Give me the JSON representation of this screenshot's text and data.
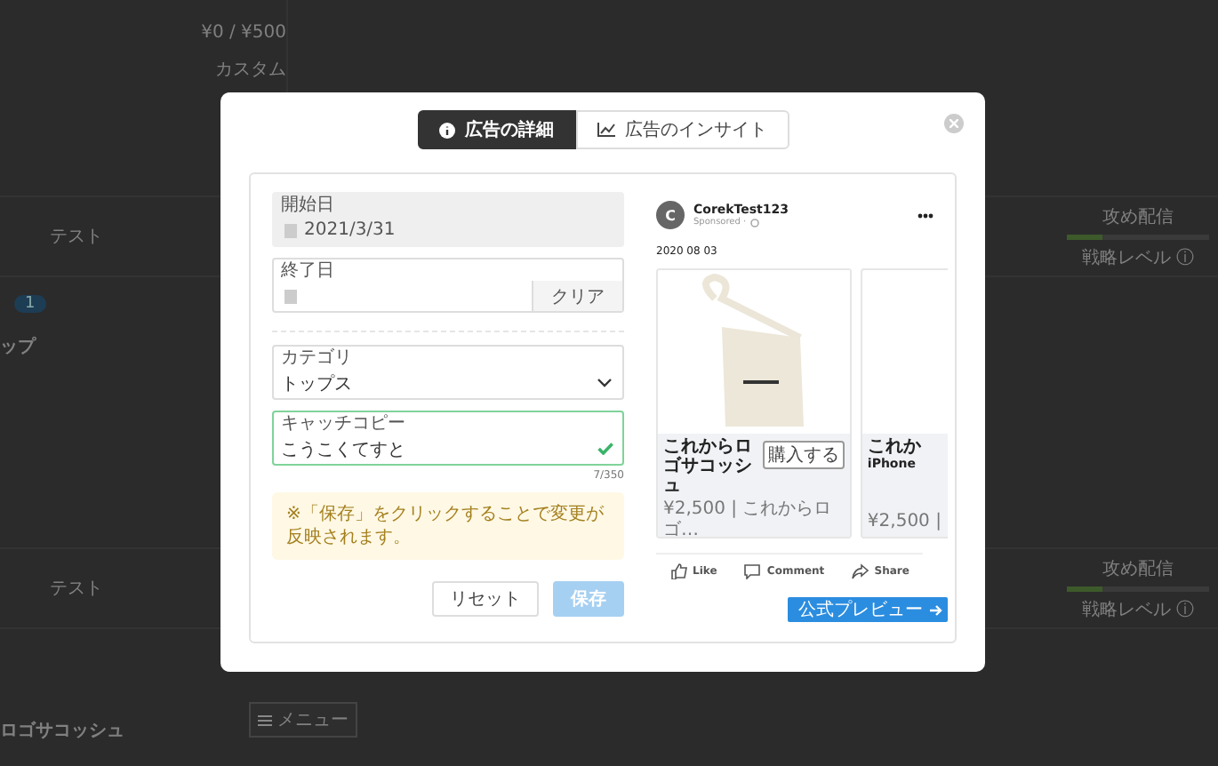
{
  "background": {
    "budget": "¥0 / ¥500",
    "plan": "カスタム",
    "rows": [
      {
        "name": "テスト",
        "strategy": "攻め配信",
        "level": 0.25,
        "level_label": "戦略レベル ⓘ",
        "badge": "1",
        "product": "ップ"
      },
      {
        "name": "テスト",
        "strategy": "攻め配信",
        "level": 0.25,
        "level_label": "戦略レベル ⓘ",
        "product": "ロゴサコッシュ",
        "menu": "メニュー"
      }
    ]
  },
  "modal": {
    "tabs": [
      {
        "label": "広告の詳細",
        "selected": true
      },
      {
        "label": "広告のインサイト",
        "selected": false
      }
    ],
    "form": {
      "fields": [
        {
          "kind": "date",
          "label": "開始日",
          "value": "2021/3/31",
          "disabled": true
        },
        {
          "kind": "date",
          "label": "終了日",
          "disabled": false,
          "clear_button": "クリア"
        },
        {
          "kind": "select",
          "label": "カテゴリ",
          "value": "トップス"
        },
        {
          "kind": "text",
          "label": "キャッチコピー",
          "value": "こうこくてすと",
          "valid": true,
          "counter": "7/350"
        }
      ],
      "notice": "※「保存」をクリックすることで変更が反映されます。",
      "reset_button": "リセット",
      "save_button": {
        "label": "保存",
        "disabled": true
      }
    },
    "preview": {
      "avatar": "C",
      "page_name": "CorekTest123",
      "sponsored": "Sponsored ·",
      "date": "2020 08 03",
      "cards": [
        {
          "title": "これからロゴサコッシュ",
          "price": "¥2,500 | これからロゴ…",
          "cta": "購入する"
        },
        {
          "title": "これか",
          "subtitle": "iPhone",
          "price": "¥2,500 |"
        }
      ],
      "actions": [
        "Like",
        "Comment",
        "Share"
      ],
      "official_button": "公式プレビュー"
    }
  }
}
